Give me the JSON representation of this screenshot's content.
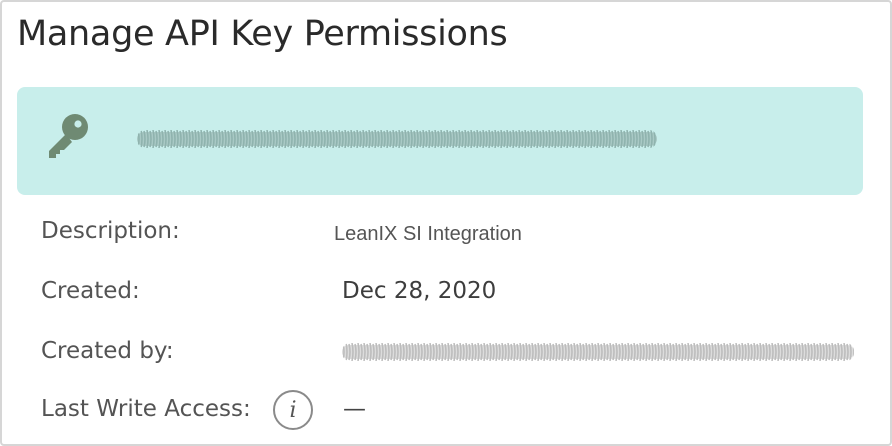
{
  "title": "Manage API Key Permissions",
  "key_card": {
    "icon": "key-icon",
    "background_color": "#c8eeeb",
    "key_value": "[redacted]"
  },
  "details": {
    "description_label": "Description:",
    "description_value": "LeanIX SI Integration",
    "created_label": "Created:",
    "created_value": "Dec 28, 2020",
    "created_by_label": "Created by:",
    "created_by_value": "[redacted]",
    "last_write_label": "Last Write Access:",
    "last_write_value": "—",
    "info_icon": "info-icon",
    "info_glyph": "i"
  }
}
